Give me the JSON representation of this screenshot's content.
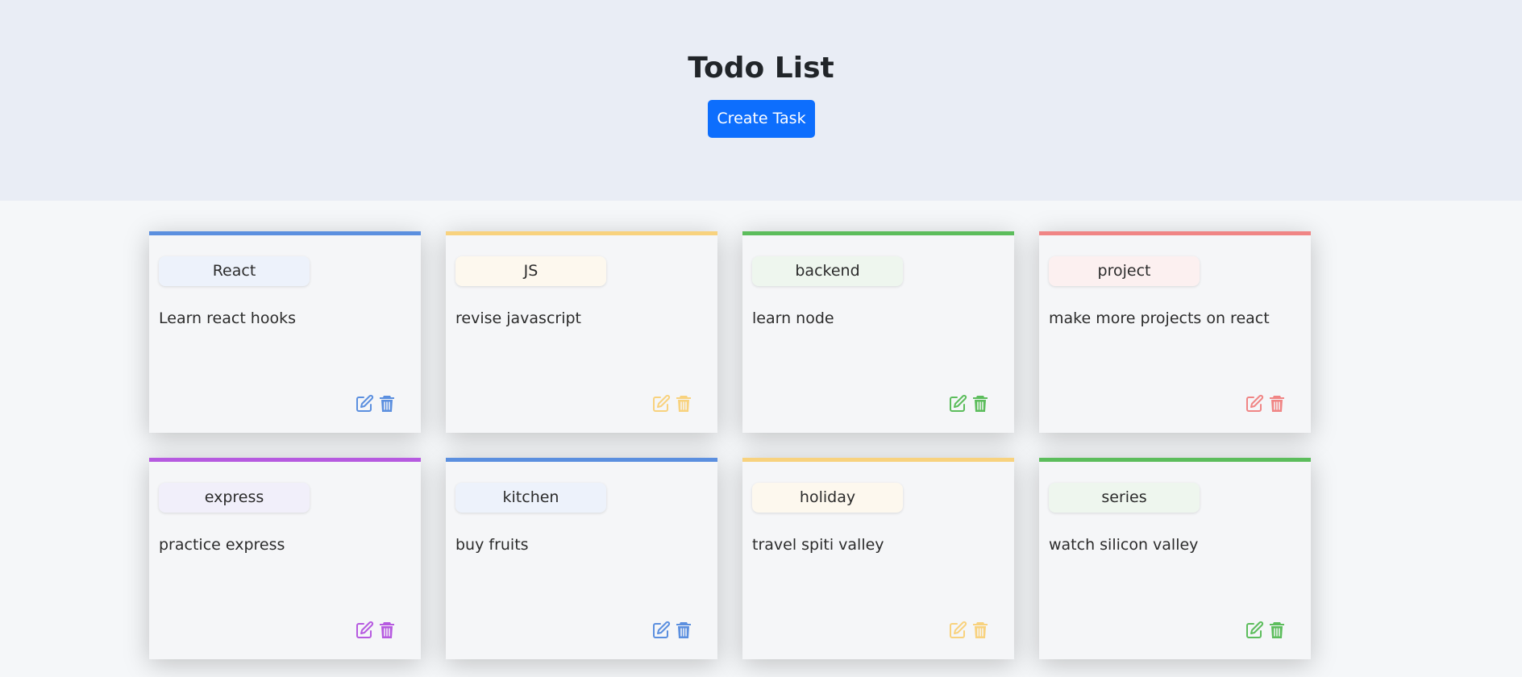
{
  "header": {
    "title": "Todo List",
    "create_label": "Create Task"
  },
  "tasks": [
    {
      "tag": "React",
      "desc": "Learn react hooks",
      "color": "#5b8fdf",
      "tint": "#edf2fb"
    },
    {
      "tag": "JS",
      "desc": "revise javascript",
      "color": "#f8d27e",
      "tint": "#fdf8ee"
    },
    {
      "tag": "backend",
      "desc": "learn node",
      "color": "#5cbd5c",
      "tint": "#eef6ee"
    },
    {
      "tag": "project",
      "desc": "make more projects on react",
      "color": "#f08585",
      "tint": "#fcf0f0"
    },
    {
      "tag": "express",
      "desc": "practice express",
      "color": "#b65ae0",
      "tint": "#f1effa"
    },
    {
      "tag": "kitchen",
      "desc": "buy fruits",
      "color": "#5b8fdf",
      "tint": "#edf2fb"
    },
    {
      "tag": "holiday",
      "desc": "travel spiti valley",
      "color": "#f8d27e",
      "tint": "#fdf8ee"
    },
    {
      "tag": "series",
      "desc": "watch silicon valley",
      "color": "#5cbd5c",
      "tint": "#eef6ee"
    }
  ],
  "icons": {
    "edit": "edit-icon",
    "delete": "trash-icon"
  }
}
